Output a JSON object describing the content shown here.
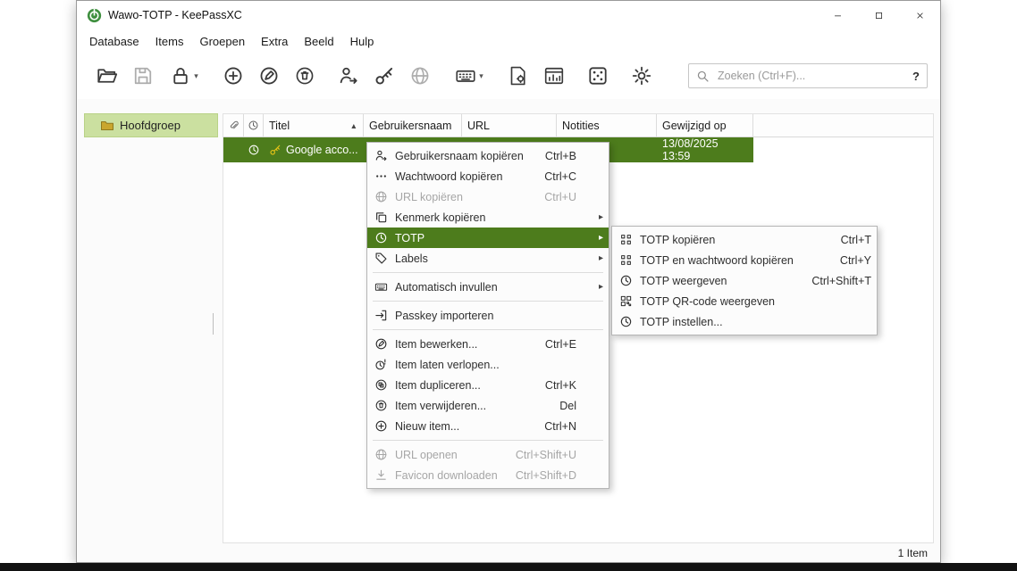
{
  "window": {
    "title": "Wawo-TOTP - KeePassXC",
    "controls": [
      "minimize",
      "maximize",
      "close"
    ]
  },
  "menubar": {
    "items": [
      {
        "label": "Database"
      },
      {
        "label": "Items"
      },
      {
        "label": "Groepen"
      },
      {
        "label": "Extra"
      },
      {
        "label": "Beeld"
      },
      {
        "label": "Hulp"
      }
    ]
  },
  "toolbar": {
    "buttons": [
      "open-database",
      "save-database",
      "lock-databases",
      "new-entry",
      "edit-entry",
      "delete-entry",
      "copy-username",
      "copy-password",
      "copy-url",
      "perform-autotype",
      "database-settings",
      "reports",
      "password-generator",
      "application-settings"
    ],
    "disabled_buttons": [
      "save-database",
      "copy-url"
    ],
    "search": {
      "placeholder": "Zoeken (Ctrl+F)..."
    },
    "help": "?"
  },
  "sidebar": {
    "groups": [
      {
        "label": "Hoofdgroep",
        "selected": true
      }
    ]
  },
  "entry_table": {
    "icon_columns": [
      "paperclip-icon",
      "clock-icon"
    ],
    "columns": [
      {
        "label": "Titel",
        "sorted": "asc"
      },
      {
        "label": "Gebruikersnaam"
      },
      {
        "label": "URL"
      },
      {
        "label": "Notities"
      },
      {
        "label": "Gewijzigd op"
      }
    ],
    "rows": [
      {
        "title": "Google acco...",
        "username": "",
        "url": "",
        "notes": "",
        "modified": "13/08/2025 13:59",
        "selected": true,
        "has_totp": true
      }
    ]
  },
  "context_menu": {
    "items": [
      {
        "label": "Gebruikersnaam kopiëren",
        "shortcut": "Ctrl+B"
      },
      {
        "label": "Wachtwoord kopiëren",
        "shortcut": "Ctrl+C"
      },
      {
        "label": "URL kopiëren",
        "shortcut": "Ctrl+U",
        "disabled": true
      },
      {
        "label": "Kenmerk kopiëren",
        "submenu": true
      },
      {
        "label": "TOTP",
        "submenu": true,
        "highlighted": true
      },
      {
        "label": "Labels",
        "submenu": true
      },
      {
        "label": "Automatisch invullen",
        "submenu": true
      },
      {
        "label": "Passkey importeren"
      },
      {
        "label": "Item bewerken...",
        "shortcut": "Ctrl+E"
      },
      {
        "label": "Item laten verlopen..."
      },
      {
        "label": "Item dupliceren...",
        "shortcut": "Ctrl+K"
      },
      {
        "label": "Item verwijderen...",
        "shortcut": "Del"
      },
      {
        "label": "Nieuw item...",
        "shortcut": "Ctrl+N"
      },
      {
        "label": "URL openen",
        "shortcut": "Ctrl+Shift+U",
        "disabled": true
      },
      {
        "label": "Favicon downloaden",
        "shortcut": "Ctrl+Shift+D",
        "disabled": true
      }
    ]
  },
  "totp_submenu": {
    "items": [
      {
        "label": "TOTP kopiëren",
        "shortcut": "Ctrl+T"
      },
      {
        "label": "TOTP en wachtwoord kopiëren",
        "shortcut": "Ctrl+Y"
      },
      {
        "label": "TOTP weergeven",
        "shortcut": "Ctrl+Shift+T"
      },
      {
        "label": "TOTP QR-code weergeven"
      },
      {
        "label": "TOTP instellen..."
      }
    ]
  },
  "statusbar": {
    "count": "1 Item"
  },
  "icons": {
    "sort_asc": "▲",
    "submenu_arrow": "▸",
    "dropdown_arrow": "▾"
  },
  "colors": {
    "selection": "#4d7c1c",
    "group_selected_bg": "#cbe0a0",
    "disabled_text": "#a6a6a6",
    "key_icon": "#e8c417"
  }
}
